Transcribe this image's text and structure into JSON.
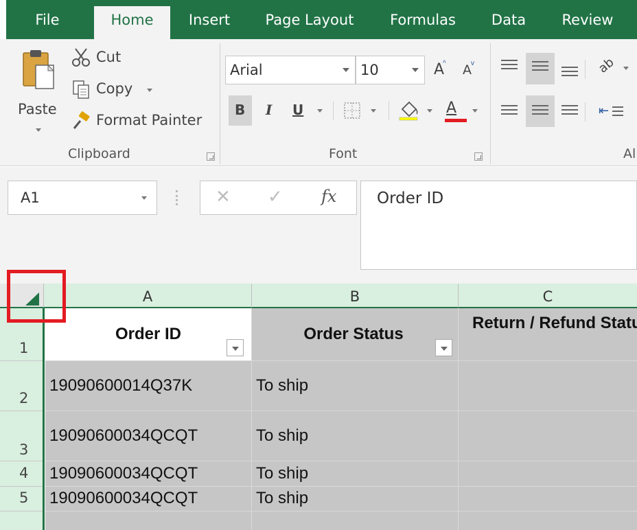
{
  "tabs": [
    "File",
    "Home",
    "Insert",
    "Page Layout",
    "Formulas",
    "Data",
    "Review"
  ],
  "ribbon": {
    "clipboard": {
      "paste": "Paste",
      "cut": "Cut",
      "copy": "Copy",
      "format_painter": "Format Painter",
      "group_label": "Clipboard"
    },
    "font": {
      "family": "Arial",
      "size": "10",
      "bold": "B",
      "italic": "I",
      "underline": "U",
      "font_color": "A",
      "group_label": "Font"
    },
    "alignment": {
      "group_label_partial": "Al"
    }
  },
  "formula_bar": {
    "name_box": "A1",
    "fx": "fx",
    "content": "Order ID"
  },
  "grid": {
    "columns": [
      "A",
      "B",
      "C"
    ],
    "rows": [
      {
        "num": "1",
        "cells": [
          "Order ID",
          "Order Status",
          "Return / Refund Status"
        ]
      },
      {
        "num": "2",
        "cells": [
          "19090600014Q37K",
          "To ship",
          ""
        ]
      },
      {
        "num": "3",
        "cells": [
          "19090600034QCQT",
          "To ship",
          ""
        ]
      },
      {
        "num": "4",
        "cells": [
          "19090600034QCQT",
          "To ship",
          ""
        ]
      },
      {
        "num": "5",
        "cells": [
          "19090600034QCQT",
          "To ship",
          ""
        ]
      }
    ]
  },
  "colors": {
    "excel_green": "#217346",
    "header_fill": "#d9efdf",
    "selection_fill": "#c6c6c6",
    "highlight_red": "#e31b23"
  }
}
